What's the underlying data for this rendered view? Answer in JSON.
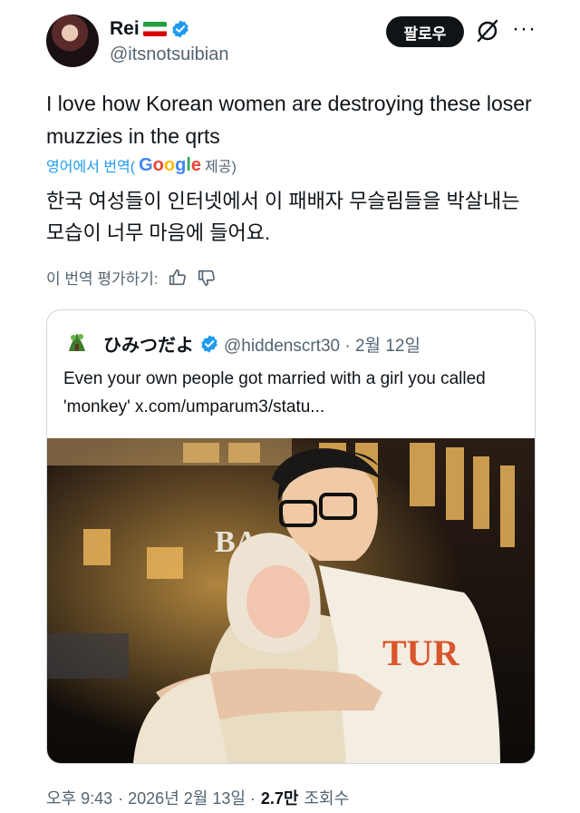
{
  "author": {
    "display_name": "Rei",
    "flag_icon": "iran-flag-icon",
    "verified_icon": "verified-badge-icon",
    "handle": "@itsnotsuibian",
    "accent_color": "#1d9bf0"
  },
  "header": {
    "follow_label": "팔로우",
    "grok_icon": "grok-slash-icon",
    "more_icon": "more-dots-icon"
  },
  "tweet": {
    "text": "I love how Korean women are destroying these loser muzzies in the qrts",
    "translated_prefix": "영어에서 번역(",
    "translated_by": "Google",
    "translated_suffix": " 제공)",
    "translated_text": "한국 여성들이 인터넷에서 이 패배자 무슬림들을 박살내는 모습이 너무 마음에 들어요.",
    "rate_label": "이 번역 평가하기:",
    "thumbs_up_icon": "thumbs-up-icon",
    "thumbs_down_icon": "thumbs-down-icon"
  },
  "quote": {
    "display_name": "ひみつだよ",
    "handle": "@hiddenscrt30",
    "date": "· 2월 12일",
    "text": "Even your own people got married with a girl you called 'monkey'  x.com/umparum3/statu...",
    "photo_desc_icon": "photo-image"
  },
  "footer": {
    "time": "오후 9:43",
    "date": "· 2026년 2월 13일 ·",
    "views_count": "2.7만",
    "views_label": "조회수"
  }
}
